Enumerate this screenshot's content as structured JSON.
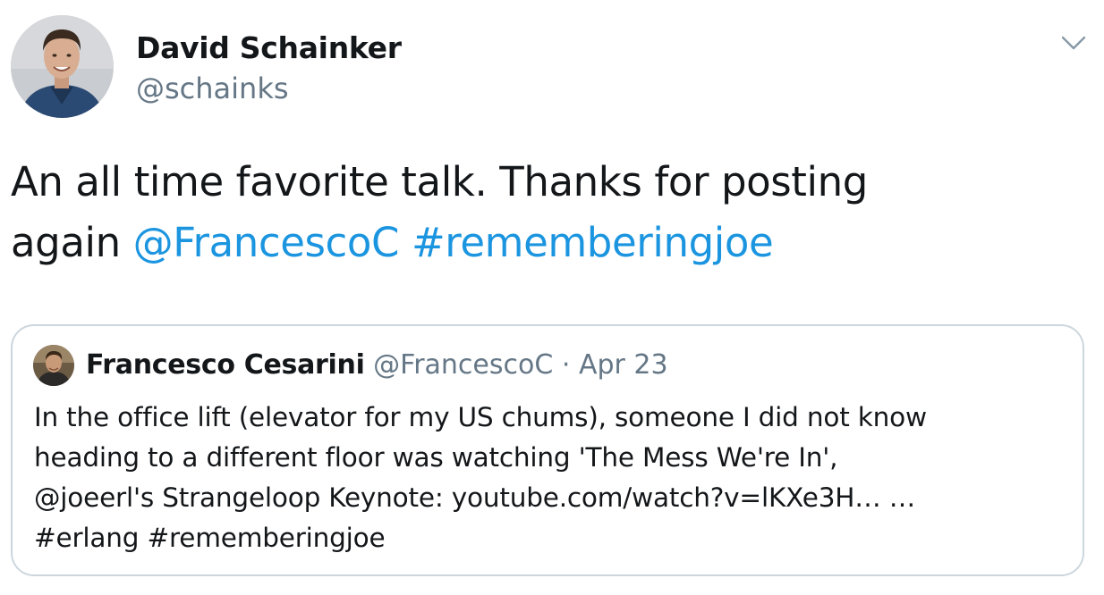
{
  "tweet": {
    "display_name": "David Schainker",
    "handle": "@schainks",
    "text_line1": "An all time favorite talk. Thanks for posting",
    "text_line2_prefix": "again ",
    "mention": "@FrancescoC",
    "hashtag": "#rememberingjoe",
    "caret_icon": "chevron-down-icon"
  },
  "quoted_tweet": {
    "display_name": "Francesco Cesarini",
    "handle": "@FrancescoC",
    "separator": "·",
    "date": "Apr 23",
    "line1": "In the office lift (elevator for my US chums), someone I did not know",
    "line2": "heading to a different floor was watching 'The Mess We're In',",
    "line3_mention": "@joeerl",
    "line3_rest": "'s Strangeloop Keynote: ",
    "line3_link": "youtube.com/watch?v=lKXe3H…",
    "line3_ellipsis": " …",
    "hashtag1": "#erlang",
    "hashtag2": "#rememberingjoe"
  },
  "colors": {
    "link": "#1b95e0",
    "text": "#14171a",
    "secondary": "#657786",
    "border": "#ccd6dd"
  }
}
